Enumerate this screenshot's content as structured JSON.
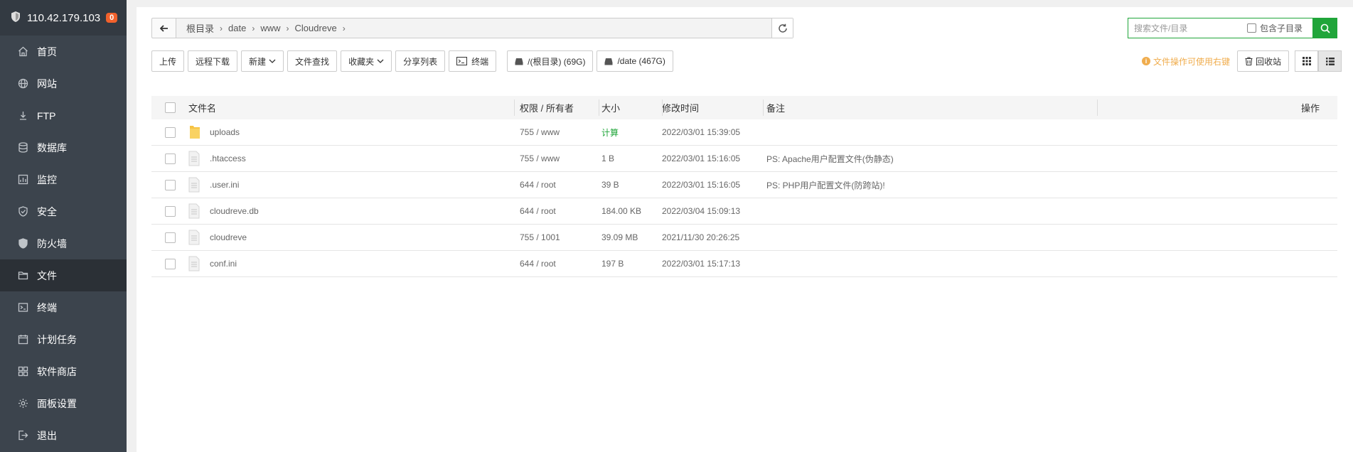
{
  "sidebar": {
    "ip": "110.42.179.103",
    "badge": "0",
    "items": [
      {
        "label": "首页",
        "icon": "home-icon"
      },
      {
        "label": "网站",
        "icon": "globe-icon"
      },
      {
        "label": "FTP",
        "icon": "ftp-icon"
      },
      {
        "label": "数据库",
        "icon": "database-icon"
      },
      {
        "label": "监控",
        "icon": "monitor-icon"
      },
      {
        "label": "安全",
        "icon": "shield-check-icon"
      },
      {
        "label": "防火墙",
        "icon": "firewall-icon"
      },
      {
        "label": "文件",
        "icon": "folder-icon"
      },
      {
        "label": "终端",
        "icon": "terminal-icon"
      },
      {
        "label": "计划任务",
        "icon": "calendar-icon"
      },
      {
        "label": "软件商店",
        "icon": "apps-icon"
      },
      {
        "label": "面板设置",
        "icon": "gear-icon"
      },
      {
        "label": "退出",
        "icon": "logout-icon"
      }
    ],
    "active_index": 7
  },
  "breadcrumb": {
    "segments": [
      "根目录",
      "date",
      "www",
      "Cloudreve"
    ]
  },
  "search": {
    "placeholder": "搜索文件/目录",
    "include_sub_label": "包含子目录"
  },
  "toolbar": {
    "upload": "上传",
    "remote_download": "远程下载",
    "new": "新建",
    "find": "文件查找",
    "favorites": "收藏夹",
    "share_list": "分享列表",
    "terminal": "终端",
    "disk_root": "/(根目录) (69G)",
    "disk_date": "/date (467G)"
  },
  "right_tools": {
    "tip": "文件操作可使用右键",
    "recycle": "回收站"
  },
  "table": {
    "headers": {
      "name": "文件名",
      "perm": "权限 / 所有者",
      "size": "大小",
      "time": "修改时间",
      "note": "备注",
      "op": "操作"
    },
    "rows": [
      {
        "name": "uploads",
        "type": "folder",
        "perm": "755 / www",
        "size": "计算",
        "time": "2022/03/01 15:39:05",
        "note": ""
      },
      {
        "name": ".htaccess",
        "type": "file",
        "perm": "755 / www",
        "size": "1 B",
        "time": "2022/03/01 15:16:05",
        "note": "PS: Apache用户配置文件(伪静态)"
      },
      {
        "name": ".user.ini",
        "type": "file",
        "perm": "644 / root",
        "size": "39 B",
        "time": "2022/03/01 15:16:05",
        "note": "PS: PHP用户配置文件(防跨站)!"
      },
      {
        "name": "cloudreve.db",
        "type": "file",
        "perm": "644 / root",
        "size": "184.00 KB",
        "time": "2022/03/04 15:09:13",
        "note": ""
      },
      {
        "name": "cloudreve",
        "type": "file",
        "perm": "755 / 1001",
        "size": "39.09 MB",
        "time": "2021/11/30 20:26:25",
        "note": ""
      },
      {
        "name": "conf.ini",
        "type": "file",
        "perm": "644 / root",
        "size": "197 B",
        "time": "2022/03/01 15:17:13",
        "note": ""
      }
    ]
  },
  "colors": {
    "sidebar_bg": "#3c444d",
    "sidebar_active": "#2b3036",
    "accent_green": "#20a53a",
    "badge": "#f1612c",
    "tip": "#f0ad4e"
  }
}
